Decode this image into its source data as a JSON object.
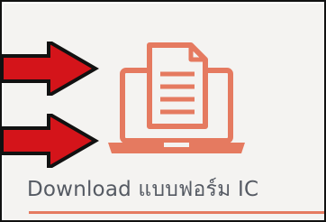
{
  "card": {
    "title": "Download แบบฟอร์ม IC",
    "icon": "document-on-laptop-icon",
    "accent_color": "#e57a60",
    "text_color": "#555a63",
    "background_color": "#f4f3f1"
  },
  "annotations": {
    "arrow_icon": "red-arrow-icon",
    "arrow_color": "#d4141a"
  }
}
